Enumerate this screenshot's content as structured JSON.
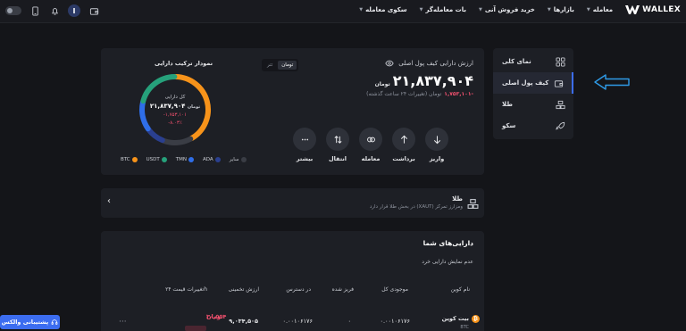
{
  "header": {
    "logo_text": "WALLEX",
    "menu": [
      {
        "label": "معامله"
      },
      {
        "label": "بازارها"
      },
      {
        "label": "خرید فروش آنی"
      },
      {
        "label": "بات معامله‌گر"
      },
      {
        "label": "سکوی معامله"
      }
    ],
    "avatar_letter": "I",
    "icons": [
      "wallet-icon",
      "bell-icon",
      "mobile-icon",
      "theme-toggle"
    ]
  },
  "sidebar": {
    "items": [
      {
        "label": "نمای کلی",
        "icon": "grid-icon"
      },
      {
        "label": "کیف پول اصلی",
        "icon": "wallet-icon",
        "active": true
      },
      {
        "label": "طلا",
        "icon": "gold-bars-icon"
      },
      {
        "label": "سکو",
        "icon": "rocket-icon"
      }
    ]
  },
  "wallet": {
    "title": "ارزش دارایی کیف پول اصلی",
    "currency_tabs": [
      "تومان",
      "تتر"
    ],
    "active_currency": "تومان",
    "balance_value": "۲۱,۸۳۷,۹۰۴",
    "balance_unit": "تومان",
    "change_value": "-۱,۷۵۳,۱۰۱",
    "change_label": "تومان (تغییرات ۲۴ ساعت گذشته)",
    "actions": [
      {
        "label": "واریز",
        "icon": "arrow-down-icon"
      },
      {
        "label": "برداشت",
        "icon": "arrow-up-icon"
      },
      {
        "label": "معامله",
        "icon": "exchange-icon"
      },
      {
        "label": "انتقال",
        "icon": "transfer-icon"
      },
      {
        "label": "بیشتر",
        "icon": "more-icon"
      }
    ]
  },
  "composition": {
    "title": "نمودار ترکیب دارایی",
    "center_label": "کل دارایی",
    "center_value": "۲۱,۸۳۷,۹۰۴",
    "center_unit": "تومان",
    "center_change": "-۱,۷۵۳,۱۰۱",
    "center_change_pct": "-۸.۰۳٪",
    "legend": [
      {
        "label": "سایر",
        "color": "#3a3d45"
      },
      {
        "label": "ADA",
        "color": "#2a3f8f"
      },
      {
        "label": "TMN",
        "color": "#2f6ee8"
      },
      {
        "label": "USDT",
        "color": "#26a17b"
      },
      {
        "label": "BTC",
        "color": "#f7931a"
      }
    ],
    "segments": [
      {
        "name": "BTC",
        "fraction": 0.42,
        "color": "#f7931a"
      },
      {
        "name": "سایر",
        "fraction": 0.14,
        "color": "#3a3d45"
      },
      {
        "name": "ADA",
        "fraction": 0.09,
        "color": "#2a3f8f"
      },
      {
        "name": "TMN",
        "fraction": 0.14,
        "color": "#2f6ee8"
      },
      {
        "name": "USDT",
        "fraction": 0.21,
        "color": "#26a17b"
      }
    ]
  },
  "gold": {
    "title": "طلا",
    "description": "ومزارز تمرکز (XAUT) در بخش طلا قرار دارد"
  },
  "assets": {
    "title": "دارایی‌های شما",
    "hide_zero_label": "عدم نمایش دارایی خرد",
    "columns": [
      "نام کوین",
      "موجودی کل",
      "فریز شده",
      "در دسترس",
      "ارزش تخمینی",
      "تغییرات قیمت ۲۴h"
    ],
    "rows": [
      {
        "name": "بیت کوین",
        "symbol": "BTC",
        "total": "۰.۰۰۱۰۶۱۷۶",
        "frozen": "۰",
        "available": "۰.۰۰۱۰۶۱۷۶",
        "estimated": "۹,۰۳۴,۵۰۵",
        "change": "۳۰,۵۵۴",
        "change_unit": "تومان"
      }
    ]
  },
  "support": {
    "label": "پشتیبانی والکس"
  },
  "colors": {
    "accent": "#3c6df0",
    "negative": "#f0506e",
    "background": "#141519",
    "card": "#1d1f25"
  }
}
